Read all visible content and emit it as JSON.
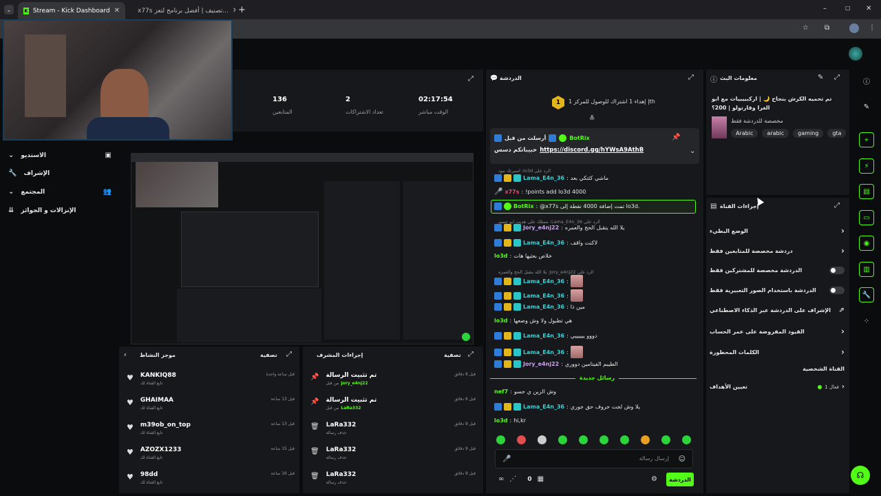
{
  "browser": {
    "tabs": [
      {
        "label": "Stream - Kick Dashboard",
        "active": true
      },
      {
        "label": "x77s تصنيف | أفضل برنامج لتعز...",
        "active": false
      }
    ],
    "new_tab": "+",
    "window_controls": [
      "–",
      "▢",
      "✕"
    ]
  },
  "stats": [
    {
      "value": "136",
      "label": "المتابعين"
    },
    {
      "value": "2",
      "label": "تعداد الاشتراكات"
    },
    {
      "value": "02:17:54",
      "label": "الوقت مباشر"
    }
  ],
  "left_nav": [
    {
      "label": "الاستديو",
      "icon": "studio-icon"
    },
    {
      "label": "الإشراف",
      "icon": "wrench-icon"
    },
    {
      "label": "المجتمع",
      "icon": "community-icon"
    },
    {
      "label": "الإنزالات و الجوائز",
      "icon": "drops-icon"
    }
  ],
  "activity_feed": {
    "title": "موجز النشاط",
    "filter": "تصفية",
    "items": [
      {
        "name": "KANKIQ88",
        "sub": "تابع القناة لك",
        "time": "قبل ساعة واحدة"
      },
      {
        "name": "GHAIMAA",
        "sub": "تابع القناة لك",
        "time": "قبل 13 ساعة"
      },
      {
        "name": "m39ob_on_top",
        "sub": "تابع القناة لك",
        "time": "قبل 13 ساعة"
      },
      {
        "name": "AZOZX1233",
        "sub": "تابع القناة لك",
        "time": "قبل 15 ساعة"
      },
      {
        "name": "98dd",
        "sub": "تابع القناة لك",
        "time": "قبل 16 ساعة"
      }
    ]
  },
  "mod_actions": {
    "title": "إجراءات المشرف",
    "filter": "تصفية",
    "items": [
      {
        "action": "تم تثبيت الرسالة",
        "by_prefix": "من قبل",
        "by": "Jory_e4nj22",
        "time": "قبل 6 دقائق",
        "icon": "pin-icon"
      },
      {
        "action": "تم تثبيت الرسالة",
        "by_prefix": "من قبل",
        "by": "LaRa332",
        "time": "قبل 6 دقائق",
        "icon": "pin-icon"
      },
      {
        "action": "LaRa332",
        "by_prefix": "حذف رسالة",
        "by": "",
        "time": "قبل 9 دقائق",
        "icon": "trash-icon"
      },
      {
        "action": "LaRa332",
        "by_prefix": "حذف رسالة",
        "by": "",
        "time": "قبل 9 دقائق",
        "icon": "trash-icon"
      },
      {
        "action": "LaRa332",
        "by_prefix": "حذف رسالة",
        "by": "",
        "time": "قبل 9 دقائق",
        "icon": "trash-icon"
      }
    ]
  },
  "chat": {
    "title": "الدردشة",
    "goal_text": "إهداء 1 اشتراك للوصول للمركز 1 |th",
    "goal_rank": "1",
    "pinned": {
      "by": "BotRix",
      "label": "أرسلت من قبل",
      "text": "حبيباتكم دسس",
      "link": "https://discord.gg/hYWsA9AthB"
    },
    "messages": [
      {
        "reply": "الرد على lo3d: اسبرتك مود",
        "user": "Lama_E4n_36",
        "text": "ماشي كثتكي بعد",
        "color": "cyan"
      },
      {
        "user": "x77s",
        "text": "!points add lo3d 4000",
        "color": "red"
      },
      {
        "user": "BotRix",
        "text": "@x77s تمت إضافة 4000 نقطة إلى lo3d.",
        "color": "green",
        "highlight": true
      },
      {
        "reply": "الرد على Lama_E4n_36: ممثلك على هديت ابو جسم",
        "user": "Jory_e4nj22",
        "text": "يلا الله يتقبل الحج والعمره",
        "color": "violet"
      },
      {
        "user": "Lama_E4n_36",
        "text": "لاكنت واقف",
        "color": "cyan"
      },
      {
        "user": "lo3d",
        "text": "خلاص بعثيها هات",
        "color": "green"
      },
      {
        "reply": "الرد على Jory_e4nj22: يلا الله يتقبل الحج والعمره",
        "user": "Lama_E4n_36",
        "text": "",
        "color": "cyan"
      },
      {
        "user": "Lama_E4n_36",
        "text": "",
        "color": "cyan"
      },
      {
        "user": "Lama_E4n_36",
        "text": "مين ذا",
        "color": "cyan"
      },
      {
        "user": "lo3d",
        "text": "هي تطبول ولا وش وضعها",
        "color": "green"
      },
      {
        "user": "Lama_E4n_36",
        "text": "دووو ييييييي",
        "color": "cyan"
      },
      {
        "user": "Lama_E4n_36",
        "text": "",
        "color": "cyan"
      },
      {
        "user": "Jory_e4nj22",
        "text": "الطيبم الفيتامين دووري",
        "color": "violet"
      }
    ],
    "new_messages": "رسائل جديدة",
    "after": [
      {
        "user": "nef7",
        "text": "وش الزين ي حسو",
        "color": "green"
      },
      {
        "user": "Lama_E4n_36",
        "text": "يلا وش لجت حروف حق جوري",
        "color": "cyan"
      },
      {
        "user": "lo3d",
        "text": "hi,kr",
        "color": "green"
      }
    ],
    "input_placeholder": "إرسال رسالة",
    "send_label": "الدردشة",
    "points": "0"
  },
  "stream_info": {
    "title": "معلومات البث",
    "stream_title": "تم تحميه الكرش بنجاح 🌙 | اركبييييات مع ابو الغرا وقارتولو | 200؟",
    "category": "مخصصة للدردشة فقط",
    "tags": [
      "gta",
      "gaming",
      "arabic",
      "Arabic"
    ]
  },
  "channel_actions": {
    "title": "إجراءات القناة",
    "rows": [
      {
        "label": "الوضع البطيء",
        "kind": "chevron"
      },
      {
        "label": "دردشة مخصصة للمتابعين فقط",
        "kind": "chevron"
      },
      {
        "label": "الدردشة مخصصة للمشتركين فقط",
        "kind": "toggle"
      },
      {
        "label": "الدردشة باستخدام الصور التعبيرية فقط",
        "kind": "toggle"
      },
      {
        "label": "الإشراف على الدردشة عبر الذكاء الاصطناعي",
        "kind": "external"
      },
      {
        "label": "القيود المفروضة على عمر الحساب",
        "kind": "chevron"
      },
      {
        "label": "الكلمات المحظورة",
        "kind": "chevron"
      }
    ],
    "section": "القناة الشخصية",
    "goals_label": "تعيين الأهداف",
    "goals_status": "فعال 1"
  },
  "accent": "#53fc18"
}
